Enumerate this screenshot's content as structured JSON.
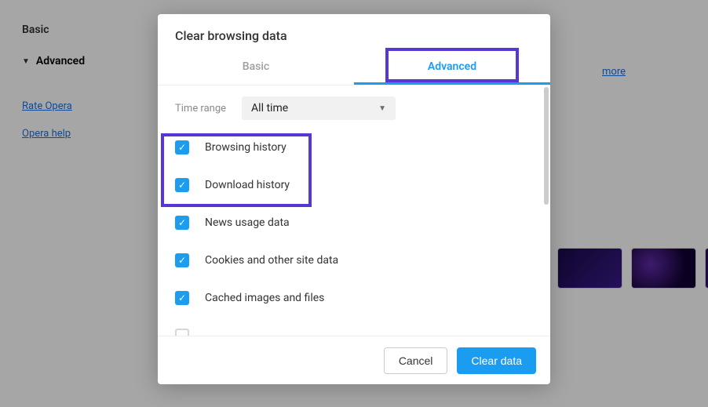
{
  "sidebar": {
    "basic": "Basic",
    "advanced": "Advanced",
    "links": {
      "rate": "Rate Opera",
      "help": "Opera help"
    }
  },
  "more": "more",
  "dialog": {
    "title": "Clear browsing data",
    "tabs": {
      "basic": "Basic",
      "advanced": "Advanced"
    },
    "time": {
      "label": "Time range",
      "value": "All time"
    },
    "items": [
      {
        "label": "Browsing history",
        "checked": true
      },
      {
        "label": "Download history",
        "checked": true
      },
      {
        "label": "News usage data",
        "checked": true
      },
      {
        "label": "Cookies and other site data",
        "checked": true
      },
      {
        "label": "Cached images and files",
        "checked": true
      }
    ],
    "buttons": {
      "cancel": "Cancel",
      "clear": "Clear data"
    }
  }
}
